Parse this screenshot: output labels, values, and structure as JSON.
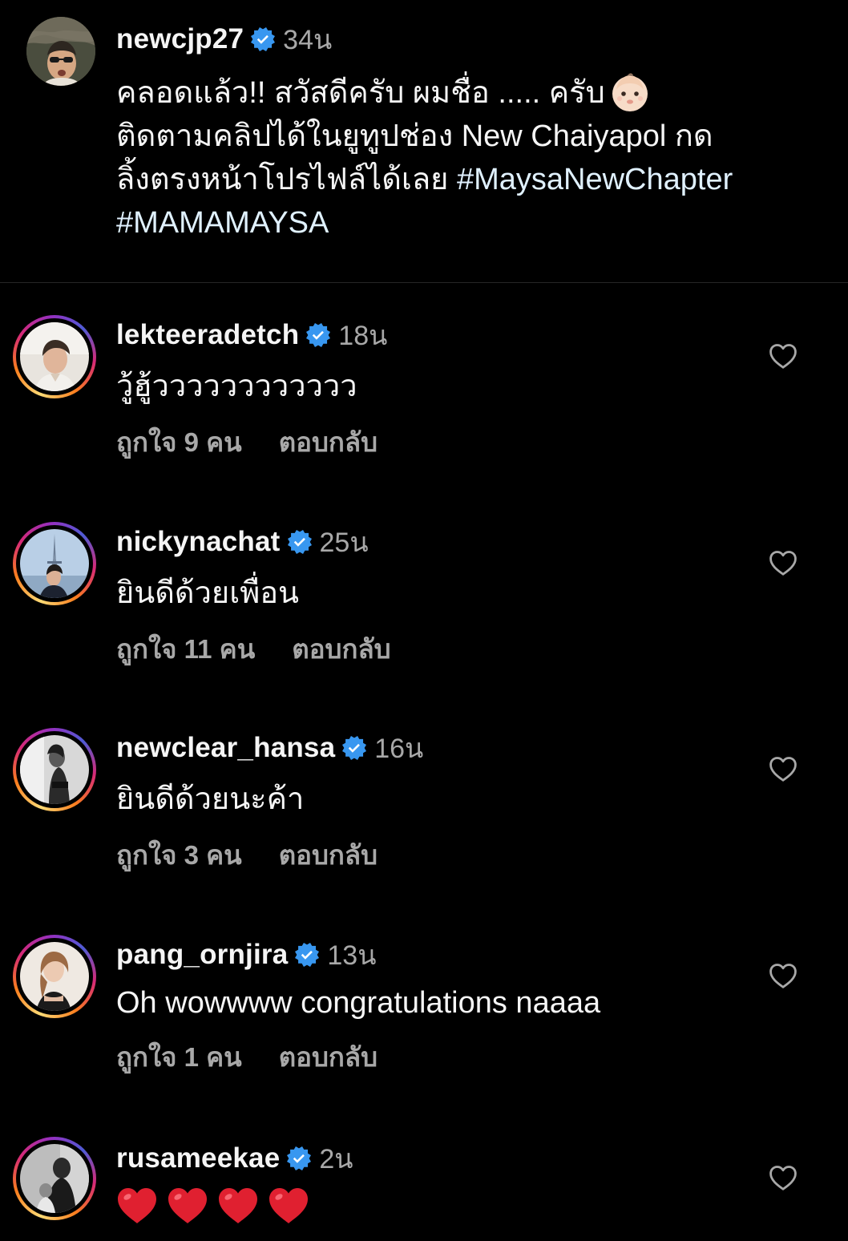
{
  "colors": {
    "background": "#000000",
    "text_primary": "#f5f5f5",
    "text_secondary": "#a8a8a8",
    "verified_badge": "#3897f0",
    "hashtag": "#e0f1ff",
    "divider": "#262626"
  },
  "caption": {
    "username": "newcjp27",
    "verified": true,
    "time": "34น",
    "text_lines": [
      "คลอดแล้ว!! สวัสดีครับ ผมชื่อ ..... ครับ",
      "ติดตามคลิปได้ในยูทูปช่อง New Chaiyapol กด",
      "ลิ้งตรงหน้าโปรไฟล์ได้เลย "
    ],
    "hashtags": [
      "#MaysaNewChapter",
      "#MAMAMAYSA"
    ],
    "emoji": "baby-emoji"
  },
  "comments": [
    {
      "username": "lekteeradetch",
      "verified": true,
      "time": "18น",
      "text": "วู้ฮู้วววววววววววว",
      "likes": "ถูกใจ 9 คน",
      "reply": "ตอบกลับ",
      "icon": "heart-outline-icon"
    },
    {
      "username": "nickynachat",
      "verified": true,
      "time": "25น",
      "text": "ยินดีด้วยเพื่อน",
      "likes": "ถูกใจ 11 คน",
      "reply": "ตอบกลับ",
      "icon": "heart-outline-icon"
    },
    {
      "username": "newclear_hansa",
      "verified": true,
      "time": "16น",
      "text": "ยินดีด้วยนะค้า",
      "likes": "ถูกใจ 3 คน",
      "reply": "ตอบกลับ",
      "icon": "heart-outline-icon"
    },
    {
      "username": "pang_ornjira",
      "verified": true,
      "time": "13น",
      "text": "Oh wowwww congratulations naaaa",
      "likes": "ถูกใจ 1 คน",
      "reply": "ตอบกลับ",
      "icon": "heart-outline-icon"
    },
    {
      "username": "rusameekae",
      "verified": true,
      "time": "2น",
      "text": "❤️❤️❤️❤️",
      "hearts": 4,
      "icon": "heart-outline-icon"
    }
  ]
}
